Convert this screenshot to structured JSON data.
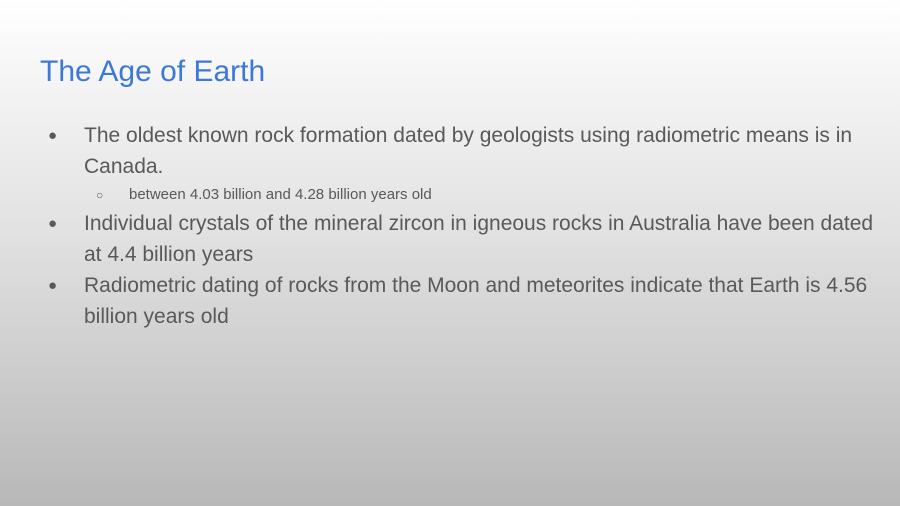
{
  "slide": {
    "title": "The Age of Earth",
    "bullets": [
      {
        "marker": "●",
        "text": "The oldest known rock formation dated by geologists using radiometric means is in Canada.",
        "sub": [
          {
            "marker": "○",
            "text": "between 4.03 billion and 4.28 billion years old"
          }
        ]
      },
      {
        "marker": "●",
        "text": "Individual crystals of the mineral zircon in igneous rocks in Australia have been dated at 4.4 billion years"
      },
      {
        "marker": "●",
        "text": "Radiometric dating of rocks from the Moon and meteorites indicate that Earth is 4.56 billion years old"
      }
    ]
  },
  "colors": {
    "title": "#3c78d8",
    "body_text": "#595959"
  }
}
